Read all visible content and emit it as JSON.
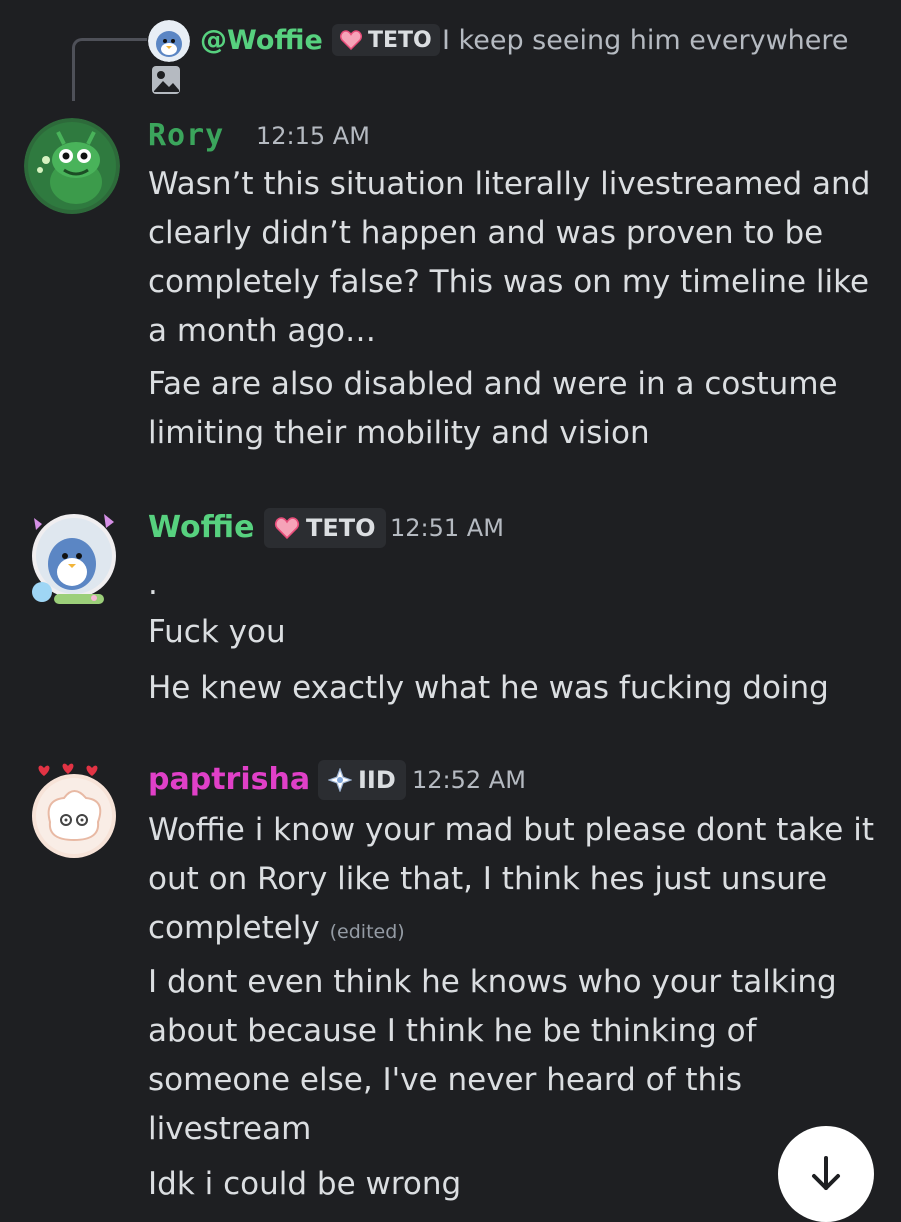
{
  "reply": {
    "username": "@Woffie",
    "badge": "TETO",
    "text": "I keep seeing him everywhere"
  },
  "messages": [
    {
      "username": "Rory",
      "username_color": "#3ba55c",
      "timestamp": "12:15 AM",
      "lines": [
        "Wasn’t this situation literally livestreamed and clearly didn’t happen and was proven to be completely false? This was on my timeline like a month ago…",
        "Fae are also disabled and were in a costume limiting their mobility and vision"
      ]
    },
    {
      "username": "Woffie",
      "username_color": "#57d17f",
      "badge": "TETO",
      "timestamp": "12:51 AM",
      "lines": [
        ".",
        "Fuck you",
        "He knew exactly what he was fucking doing"
      ]
    },
    {
      "username": "paptrisha",
      "username_color": "#e040c8",
      "badge": "IID",
      "timestamp": "12:52 AM",
      "lines": [
        "Woffie i know your mad but please dont take it out on Rory like that, I think hes just unsure completely",
        "I dont even think he knows who your talking about because I think he be thinking of someone else, I've never heard of this livestream",
        "Idk i could be wrong"
      ],
      "edited_label": "(edited)"
    }
  ]
}
